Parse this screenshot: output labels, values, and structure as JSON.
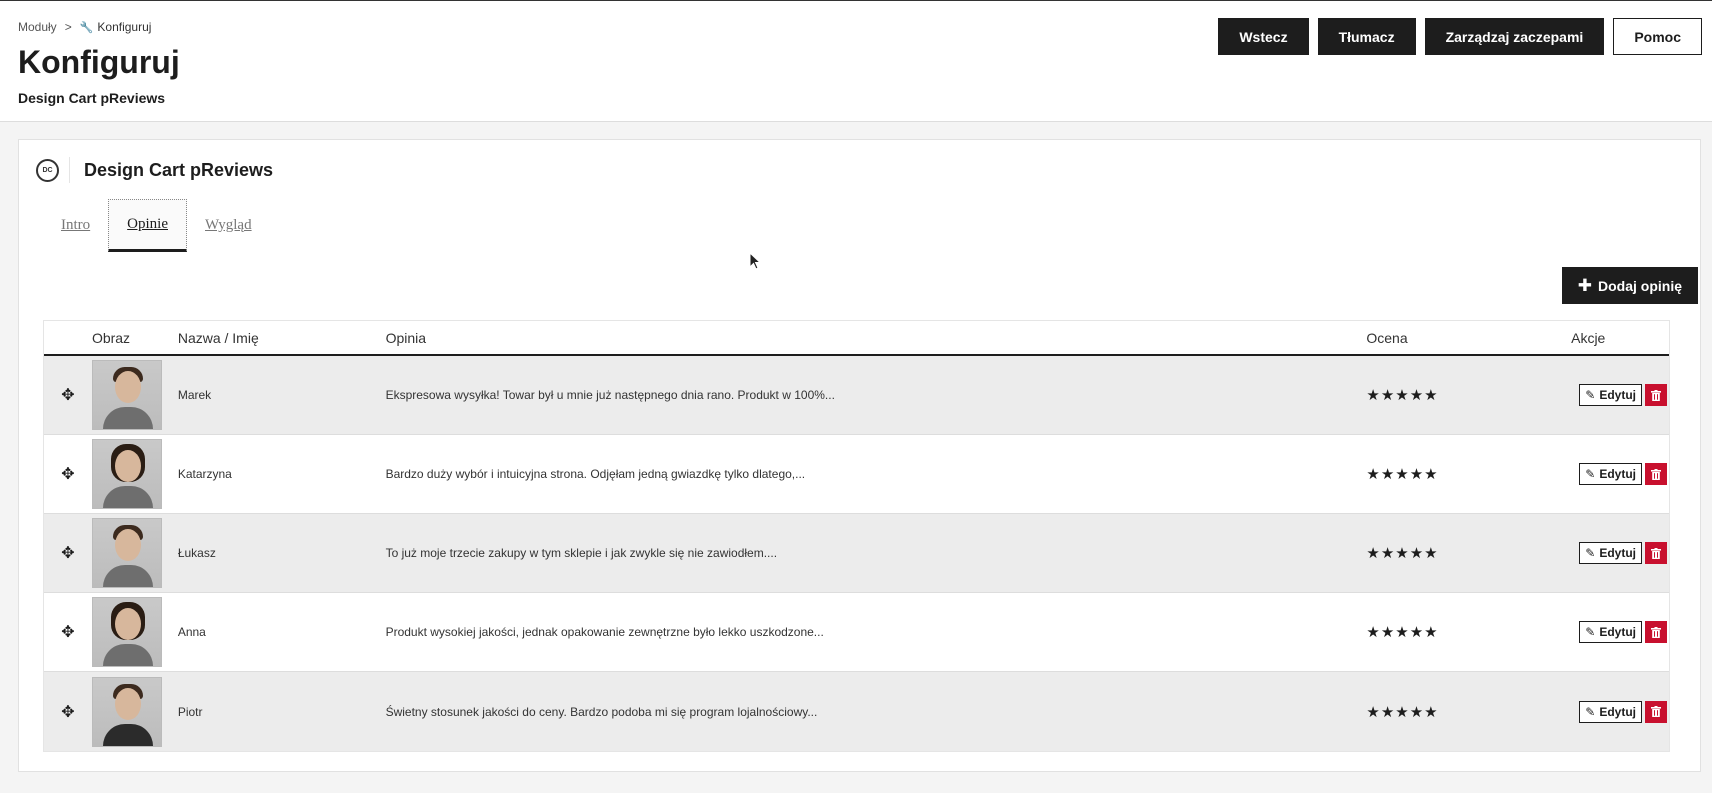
{
  "breadcrumb": {
    "parent": "Moduły",
    "separator": ">",
    "current": "Konfiguruj"
  },
  "page": {
    "title": "Konfiguruj",
    "subtitle": "Design Cart pReviews"
  },
  "toolbar": {
    "back": "Wstecz",
    "translate": "Tłumacz",
    "hooks": "Zarządzaj zaczepami",
    "help": "Pomoc"
  },
  "panel": {
    "title": "Design Cart pReviews",
    "logo_text": "DC"
  },
  "tabs": [
    {
      "label": "Intro",
      "active": false
    },
    {
      "label": "Opinie",
      "active": true
    },
    {
      "label": "Wygląd",
      "active": false
    }
  ],
  "add_button": {
    "icon": "plus-icon",
    "label": "Dodaj opinię"
  },
  "table": {
    "headers": {
      "image": "Obraz",
      "name": "Nazwa / Imię",
      "review": "Opinia",
      "rating": "Ocena",
      "actions": "Akcje"
    },
    "edit_label": "Edytuj",
    "rows": [
      {
        "name": "Marek",
        "review": "Ekspresowa wysyłka! Towar był u mnie już następnego dnia rano. Produkt w 100%...",
        "stars": "★★★★★",
        "rating": 5
      },
      {
        "name": "Katarzyna",
        "review": "Bardzo duży wybór i intuicyjna strona. Odjęłam jedną gwiazdkę tylko dlatego,...",
        "stars": "★★★★★",
        "rating": 5
      },
      {
        "name": "Łukasz",
        "review": "To już moje trzecie zakupy w tym sklepie i jak zwykle się nie zawiodłem....",
        "stars": "★★★★★",
        "rating": 5
      },
      {
        "name": "Anna",
        "review": "Produkt wysokiej jakości, jednak opakowanie zewnętrzne było lekko uszkodzone...",
        "stars": "★★★★★",
        "rating": 5
      },
      {
        "name": "Piotr",
        "review": "Świetny stosunek jakości do ceny. Bardzo podoba mi się program lojalnościowy...",
        "stars": "★★★★★",
        "rating": 5
      }
    ]
  },
  "colors": {
    "primary": "#1d1d1d",
    "danger": "#c8102e",
    "row_alt": "#ececec"
  }
}
